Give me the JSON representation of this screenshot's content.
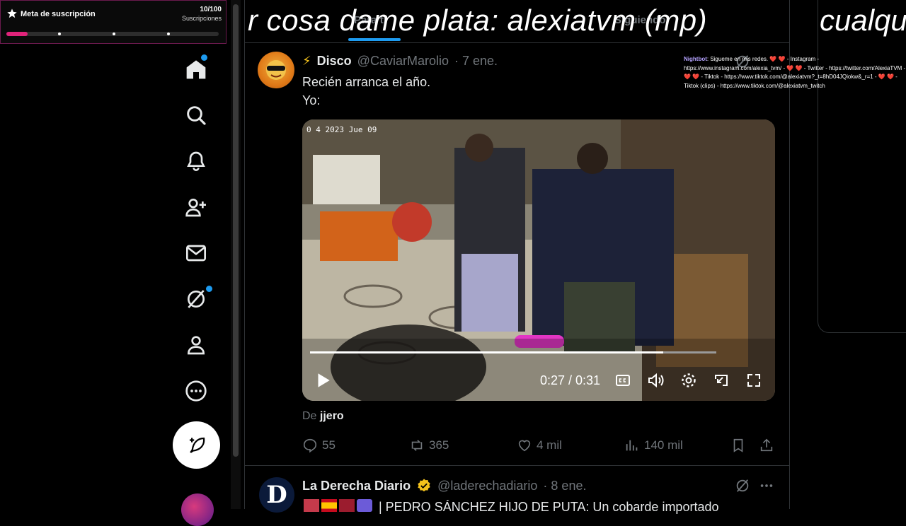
{
  "goal": {
    "title": "Meta de suscripción",
    "count": "10/100",
    "subtitle": "Suscripciones",
    "progress": 0.1
  },
  "colors": {
    "accent": "#1d9bf0",
    "goal": "#e0237a",
    "verified": "#f4c21c"
  },
  "overlay": {
    "text": "r cosa dame plata: alexiatvm (mp)",
    "right": "cualqu"
  },
  "tabs": [
    {
      "label": "Para ti"
    },
    {
      "label": "Siguiendo"
    }
  ],
  "nav": [
    "home-icon",
    "search-icon",
    "bell-icon",
    "follow-icon",
    "mail-icon",
    "grok-icon",
    "profile-icon",
    "more-icon",
    "post-icon"
  ],
  "tweet1": {
    "emoji": "⚡",
    "name": "Disco",
    "handle": "@CaviarMarolio",
    "date": "· 7 ene.",
    "line1": "Recién arranca el año.",
    "line2": "Yo:",
    "video": {
      "time": "0:27 / 0:31",
      "progress": 0.87,
      "stamp": "0 4 2023 Jue 09"
    },
    "from_label": "De",
    "from_user": "jjero",
    "replies": "55",
    "retweets": "365",
    "likes": "4 mil",
    "views": "140 mil"
  },
  "chat": {
    "user": "Nightbot",
    "message": ": Sigueme en mis redes. ❤️ ❤️ - Instagram - https://www.instagram.com/alexia_tvm/ - ❤️ ❤️ - Twitter - https://twitter.com/AlexiaTVM - ❤️ ❤️ - Tiktok - https://www.tiktok.com/@alexiatvm?_t=8hD04JQiokw&_r=1 - ❤️ ❤️ - Tiktok (clips) - https://www.tiktok.com/@alexiatvm_twitch"
  },
  "tweet2": {
    "name": "La Derecha Diario",
    "handle": "@laderechadiario",
    "date": "· 8 ene.",
    "text": "| PEDRO SÁNCHEZ HIJO DE PUTA: Un cobarde importado",
    "avatar_letter": "D"
  }
}
